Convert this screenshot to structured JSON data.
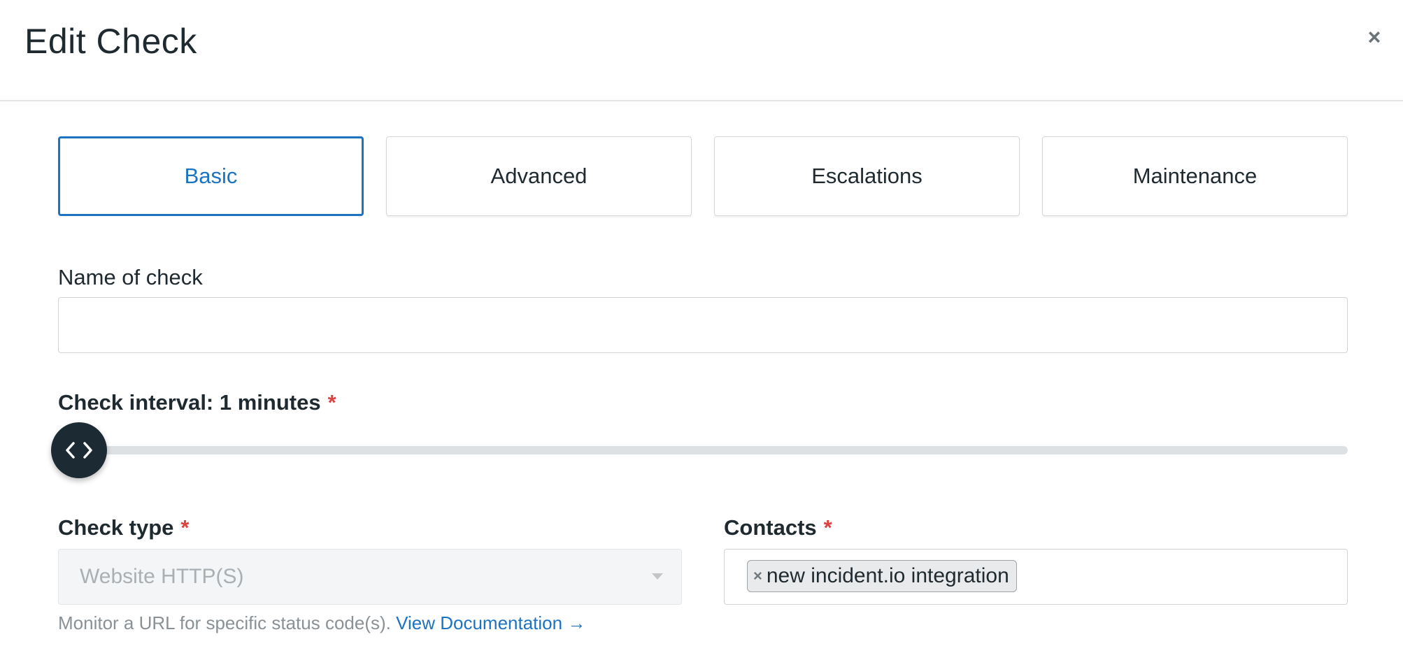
{
  "modal": {
    "title": "Edit Check",
    "close_icon": "×"
  },
  "tabs": [
    {
      "label": "Basic",
      "active": true
    },
    {
      "label": "Advanced",
      "active": false
    },
    {
      "label": "Escalations",
      "active": false
    },
    {
      "label": "Maintenance",
      "active": false
    }
  ],
  "form": {
    "name": {
      "label": "Name of check",
      "value": "",
      "placeholder": ""
    },
    "interval": {
      "label": "Check interval: 1 minutes",
      "required_mark": "*",
      "value_minutes": 1,
      "slider_position": 0
    },
    "check_type": {
      "label": "Check type",
      "required_mark": "*",
      "selected": "Website HTTP(S)",
      "disabled": true
    },
    "contacts": {
      "label": "Contacts",
      "required_mark": "*",
      "chips": [
        {
          "remove": "×",
          "label": "new incident.io integration"
        }
      ]
    },
    "help": {
      "text": "Monitor a URL for specific status code(s).",
      "link": "View Documentation →"
    }
  },
  "colors": {
    "accent": "#1b73c2",
    "required": "#e0413f",
    "handle": "#1b2a33"
  },
  "icons": {
    "close": "close-icon",
    "slider": "chevron-left-right-icon",
    "dropdown": "caret-down-icon",
    "chip_remove": "remove-icon"
  }
}
